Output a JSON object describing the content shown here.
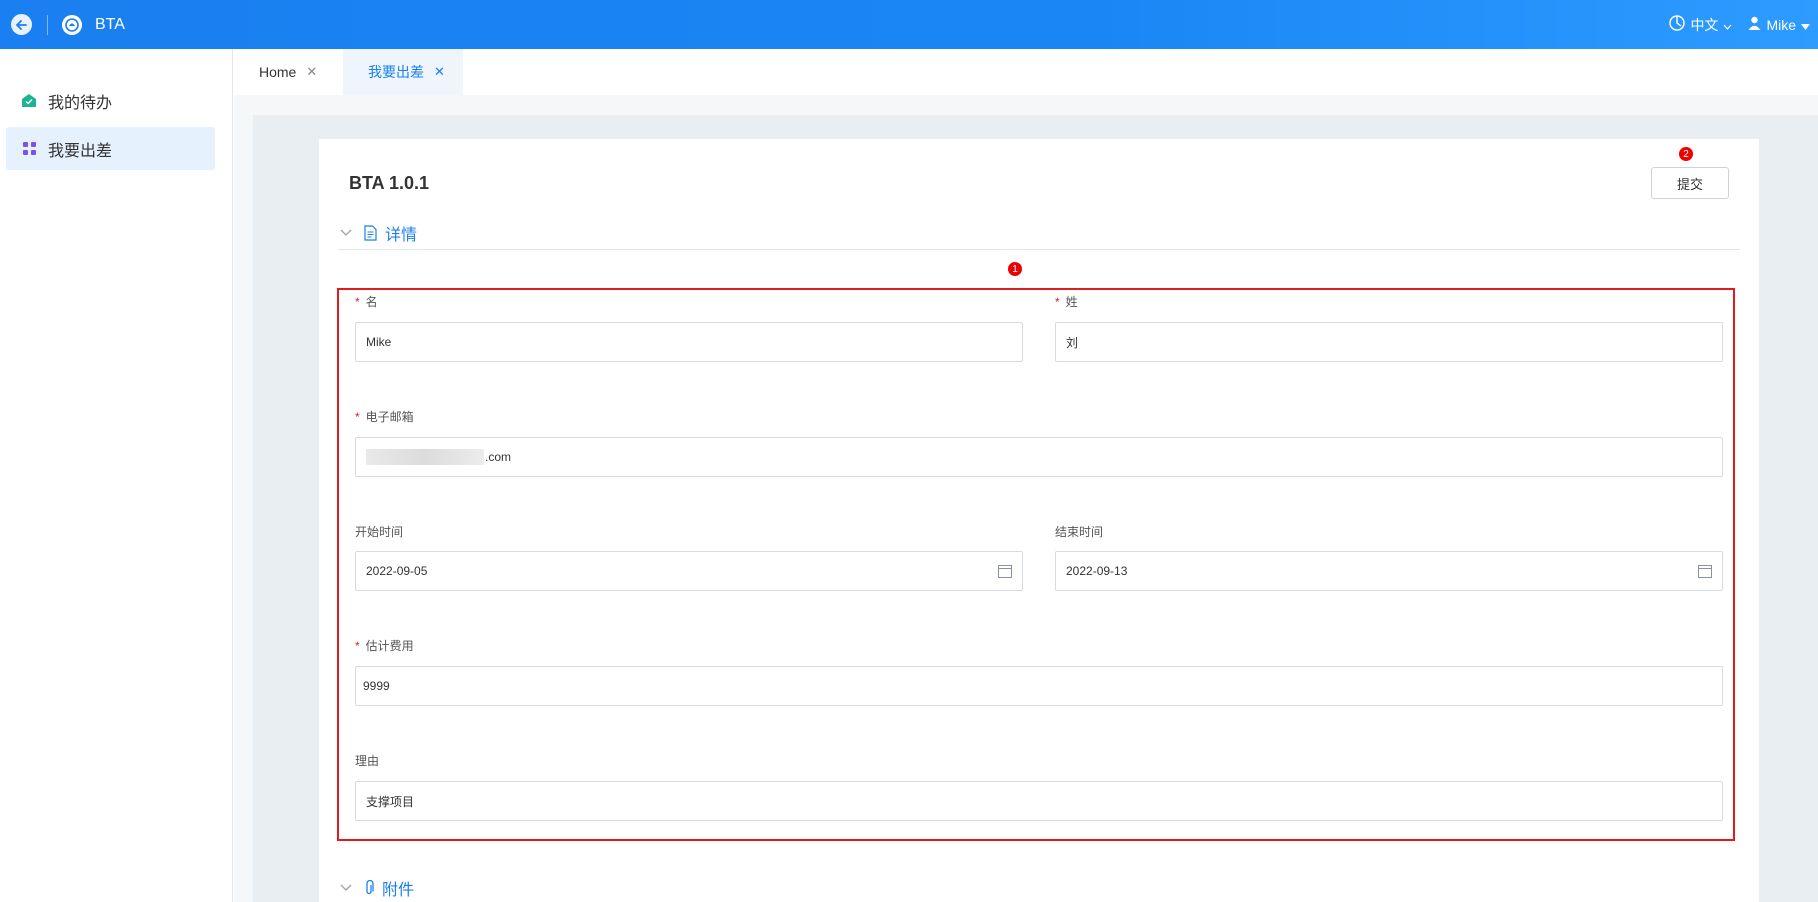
{
  "header": {
    "app_title": "BTA",
    "language": "中文",
    "user": "Mike",
    "back_icon": "back-arrow-icon",
    "logo_icon": "bta-logo-icon"
  },
  "sidebar": {
    "items": [
      {
        "label": "我的待办",
        "icon": "inbox-icon",
        "icon_color": "#1bb394"
      },
      {
        "label": "我要出差",
        "icon": "grid-icon",
        "icon_color": "#7b52e8"
      }
    ]
  },
  "tabs": [
    {
      "label": "Home"
    },
    {
      "label": "我要出差"
    }
  ],
  "page": {
    "version": "BTA 1.0.1",
    "submit_label": "提交",
    "details_section": "详情",
    "attachments_section": "附件"
  },
  "annotations": {
    "form_region_badge": "1",
    "submit_badge": "2",
    "highlight_color": "#e41b1b"
  },
  "form": {
    "first_name": {
      "label": "名",
      "required": true,
      "value": "Mike"
    },
    "last_name": {
      "label": "姓",
      "required": true,
      "value": "刘"
    },
    "email": {
      "label": "电子邮箱",
      "required": true,
      "value": ".com"
    },
    "start_date": {
      "label": "开始时间",
      "value": "2022-09-05"
    },
    "end_date": {
      "label": "结束时间",
      "value": "2022-09-13"
    },
    "cost": {
      "label": "估计费用",
      "required": true,
      "value": "9999"
    },
    "reason": {
      "label": "理由",
      "value": "支撑项目"
    }
  },
  "colors": {
    "brand": "#1a7ff0",
    "required": "#e41b1b"
  }
}
